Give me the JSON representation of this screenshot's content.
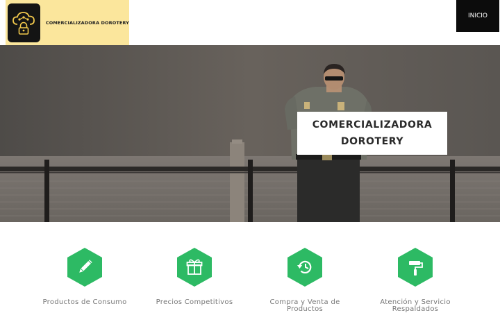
{
  "header": {
    "brand_name": "COMERCIALIZADORA DOROTERY",
    "logo_icon": "cloud-lock-logo-icon",
    "nav": {
      "home_label": "INICIO"
    },
    "colors": {
      "brand_bg": "#fbe69c",
      "nav_bg": "#0c0c0c"
    }
  },
  "hero": {
    "title_line1": "COMERCIALIZADORA",
    "title_line2": "DOROTERY",
    "image": "security-guard-photo"
  },
  "features": {
    "accent_color": "#2dba64",
    "items": [
      {
        "icon": "pencil-icon",
        "label_line1": "Productos de Consumo",
        "label_line2": ""
      },
      {
        "icon": "gift-icon",
        "label_line1": "Precios Competitivos",
        "label_line2": ""
      },
      {
        "icon": "history-icon",
        "label_line1": "Compra y Venta de",
        "label_line2": "Productos"
      },
      {
        "icon": "paint-roller-icon",
        "label_line1": "Atención y Servicio",
        "label_line2": "Respaldados"
      }
    ]
  }
}
